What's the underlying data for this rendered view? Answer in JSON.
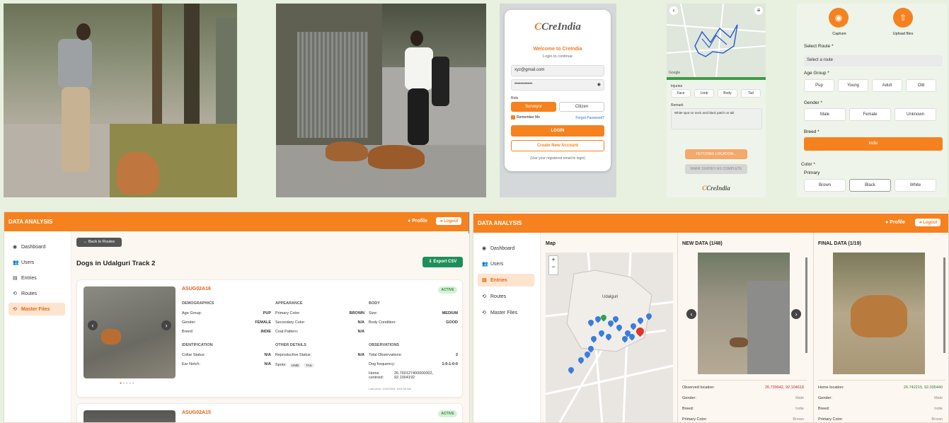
{
  "login": {
    "logo": "CreIndia",
    "welcome": "Welcome to CreIndia",
    "subtitle": "Login to continue",
    "email": "xyz@gmail.com",
    "password": "••••••••••••",
    "role_label": "Role",
    "role_surveyor": "Surveyor",
    "role_citizen": "Citizen",
    "remember": "Remember Me",
    "forgot": "Forgot Password?",
    "login_btn": "LOGIN",
    "create_btn": "Create New Account",
    "note": "(Use your registered email to login)"
  },
  "survey": {
    "injuries": "Injuries",
    "chips": [
      "Face",
      "Limb",
      "Body",
      "Tail"
    ],
    "remark_label": "Remark",
    "remark": "White spot on neck and black patch on tail",
    "fetch_btn": "FETCHING LOCATION...",
    "complete_btn": "MARK SURVEY AS COMPLETE",
    "logo": "CreIndia",
    "google": "Google"
  },
  "form": {
    "capture": "Capture",
    "upload": "Upload files",
    "route_label": "Select Route *",
    "route_placeholder": "Select a route",
    "age_label": "Age Group *",
    "ages": [
      "Pup",
      "Young",
      "Adult",
      "Old"
    ],
    "gender_label": "Gender *",
    "genders": [
      "Male",
      "Female",
      "Unknown"
    ],
    "breed_label": "Breed *",
    "breed_value": "Indie",
    "color_label": "Color *",
    "primary_label": "Primary",
    "colors": [
      "Brown",
      "Black",
      "White"
    ]
  },
  "dash1": {
    "title": "DATA ANALYSIS",
    "profile": "Profile",
    "logout": "Logout",
    "nav": [
      "Dashboard",
      "Users",
      "Entries",
      "Routes",
      "Master Files"
    ],
    "back": "← Back to Routes",
    "heading": "Dogs in Udalguri Track 2",
    "export": "Export CSV",
    "entry1": {
      "id": "ASUG02A16",
      "status": "ACTIVE",
      "demo_h": "DEMOGRAPHICS",
      "app_h": "APPEARANCE",
      "body_h": "BODY",
      "age_k": "Age Group:",
      "age_v": "PUP",
      "gender_k": "Gender:",
      "gender_v": "FEMALE",
      "breed_k": "Breed:",
      "breed_v": "INDIE",
      "pc_k": "Primary Color:",
      "pc_v": "BROWN",
      "sc_k": "Secondary Color:",
      "sc_v": "N/A",
      "cp_k": "Coat Pattern:",
      "cp_v": "N/A",
      "size_k": "Size:",
      "size_v": "MEDIUM",
      "bc_k": "Body Condition:",
      "bc_v": "GOOD",
      "id_h": "IDENTIFICATION",
      "od_h": "OTHER DETAILS",
      "obs_h": "OBSERVATIONS",
      "collar_k": "Collar Status:",
      "collar_v": "N/A",
      "ear_k": "Ear Notch:",
      "ear_v": "N/A",
      "repro_k": "Reproductive Status:",
      "repro_v": "N/A",
      "spots_k": "Spots:",
      "spots": [
        "LIMB",
        "TAIL"
      ],
      "tobs_k": "Total Observations:",
      "tobs_v": "2",
      "freq_k": "Dog frequency:",
      "freq_v": "1-0-1-0-0",
      "home_k": "Home centroid:",
      "home_v": "26.760127400000002, 92.1004192",
      "last": "Last seen: 2/15/2025, 8:53:08 AM"
    },
    "entry2": {
      "id": "ASUG02A15",
      "status": "ACTIVE"
    }
  },
  "dash2": {
    "title": "DATA ANALYSIS",
    "profile": "Profile",
    "logout": "Logout",
    "nav": [
      "Dashboard",
      "Users",
      "Entries",
      "Routes",
      "Master Files"
    ],
    "map_h": "Map",
    "town": "Udalguri",
    "new_h": "NEW DATA (1/48)",
    "final_h": "FINAL DATA (1/19)",
    "new_rows": [
      {
        "k": "Observed location:",
        "v": "26.739942, 92.104618"
      },
      {
        "k": "Gender:",
        "v": "Male"
      },
      {
        "k": "Breed:",
        "v": "Indie"
      },
      {
        "k": "Primary Color:",
        "v": "Brown"
      }
    ],
    "final_rows": [
      {
        "k": "Home location:",
        "v": "26.742215, 92.095440"
      },
      {
        "k": "Gender:",
        "v": "Male"
      },
      {
        "k": "Breed:",
        "v": "Indie"
      },
      {
        "k": "Primary Color:",
        "v": "Brown"
      }
    ],
    "zoom_in": "+",
    "zoom_out": "−"
  },
  "colors": {
    "accent": "#f5821f",
    "active": "#2f8e3f",
    "bg": "#e8f1df"
  }
}
